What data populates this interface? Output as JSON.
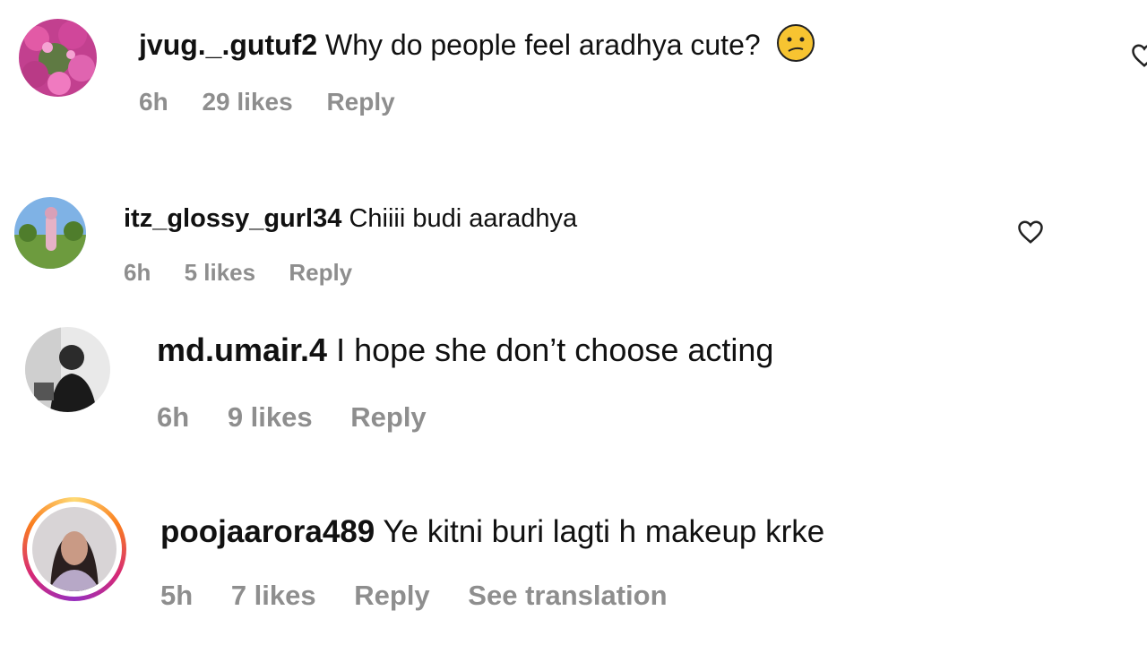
{
  "comments": [
    {
      "username": "jvug._.gutuf2",
      "text": "Why do people feel aradhya cute?",
      "emoji": "confused-face-emoji",
      "time": "6h",
      "likes": "29 likes",
      "reply": "Reply"
    },
    {
      "username": "itz_glossy_gurl34",
      "text": "Chiiii budi aaradhya",
      "time": "6h",
      "likes": "5 likes",
      "reply": "Reply"
    },
    {
      "username": "md.umair.4",
      "text": "I hope she don’t choose acting",
      "time": "6h",
      "likes": "9 likes",
      "reply": "Reply"
    },
    {
      "username": "poojaarora489",
      "text": "Ye kitni buri lagti h makeup krke",
      "time": "5h",
      "likes": "7 likes",
      "reply": "Reply",
      "translation": "See translation"
    }
  ],
  "icons": {
    "like": "heart-outline-icon",
    "story_ring": "story-ring-gradient"
  },
  "colors": {
    "text": "#111111",
    "meta": "#8e8e8e"
  }
}
